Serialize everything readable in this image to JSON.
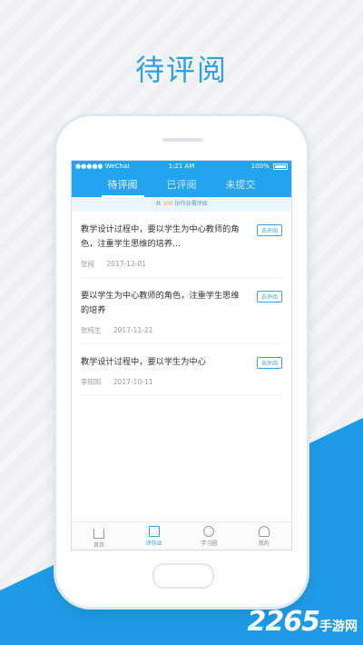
{
  "headline": "待评阅",
  "statusbar": {
    "carrier": "●●●●● WeChat",
    "time": "1:21 AM",
    "battery": "100%"
  },
  "tabs": [
    {
      "label": "待评阅",
      "active": true
    },
    {
      "label": "已评阅",
      "active": false
    },
    {
      "label": "未提交",
      "active": false
    }
  ],
  "summary": {
    "prefix": "共",
    "count": "100",
    "suffix": "份作业需评阅"
  },
  "items": [
    {
      "text": "教学设计过程中，要以学生为中心教师的角色，注重学生思维的培养…",
      "author": "张纯",
      "date": "2017-12-01",
      "action": "去评阅"
    },
    {
      "text": "要以学生为中心教师的角色，注重学生思维的培养",
      "author": "张纯生",
      "date": "2017-11-21",
      "action": "去评阅"
    },
    {
      "text": "教学设计过程中，要以学生为中心",
      "author": "李阳阳",
      "date": "2017-10-11",
      "action": "去评阅"
    }
  ],
  "bottomnav": [
    {
      "label": "首页",
      "icon": "home-icon"
    },
    {
      "label": "评作业",
      "icon": "document-icon"
    },
    {
      "label": "学习圈",
      "icon": "circle-icon"
    },
    {
      "label": "我的",
      "icon": "user-icon"
    }
  ],
  "watermark": {
    "number": "2265",
    "suffix": "手游网"
  },
  "colors": {
    "accent": "#23a4ee",
    "headline": "#2e9fe8",
    "warning": "#f39c12"
  }
}
